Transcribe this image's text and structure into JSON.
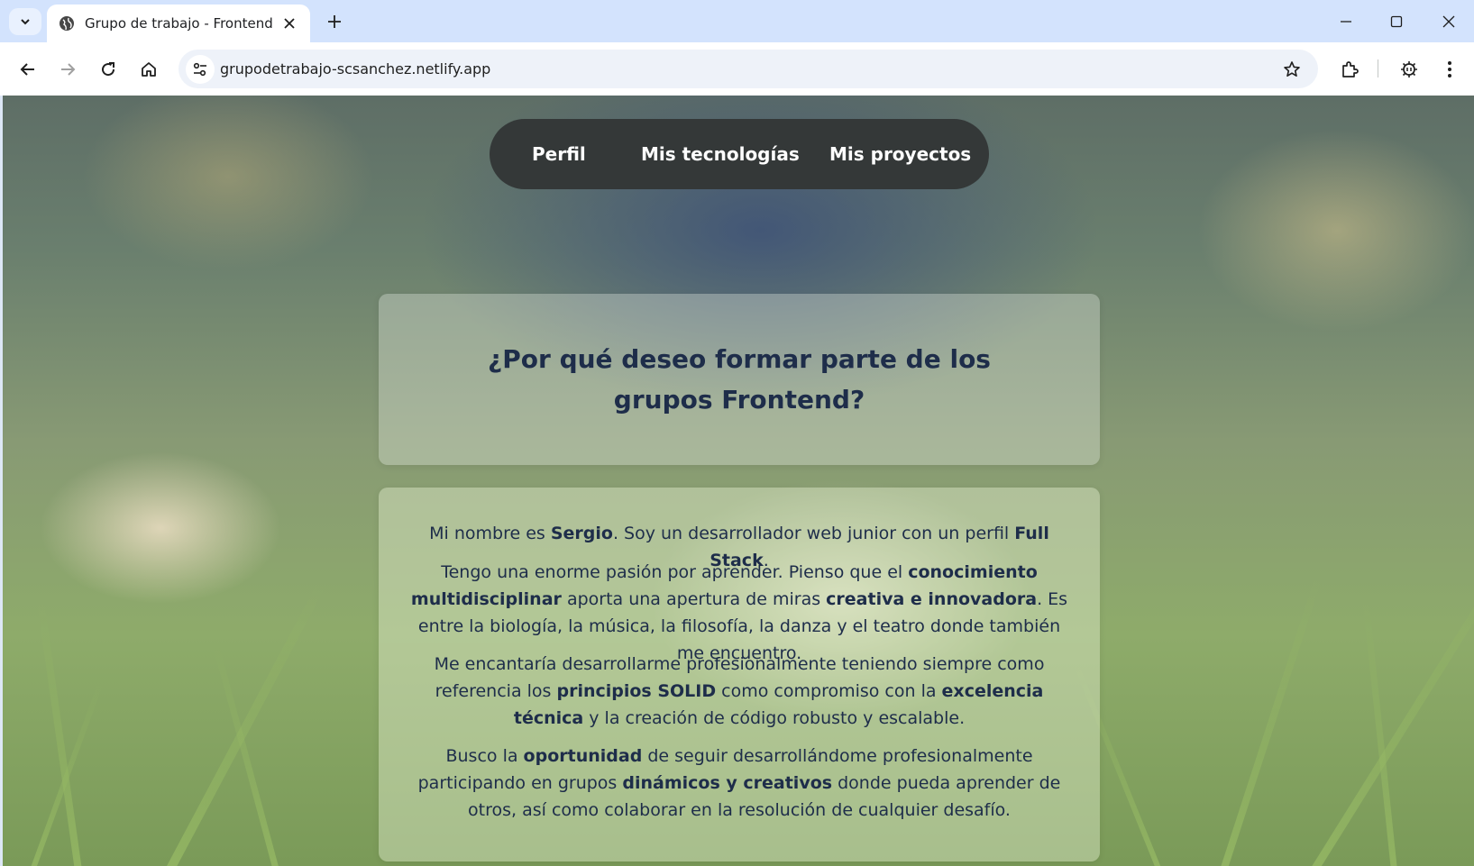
{
  "browser": {
    "tab_title": "Grupo de trabajo - Frontend",
    "url": "grupodetrabajo-scsanchez.netlify.app"
  },
  "nav": {
    "items": [
      "Perfil",
      "Mis tecnologías",
      "Mis proyectos"
    ]
  },
  "main": {
    "heading": "¿Por qué deseo formar parte de los grupos Frontend?",
    "p1": [
      "Mi nombre es ",
      "Sergio",
      ". Soy un desarrollador web junior con un perfil ",
      "Full Stack",
      "."
    ],
    "p2": [
      "Tengo una enorme pasión por aprender. Pienso que el ",
      "conocimiento multidisciplinar",
      " aporta una apertura de miras ",
      "creativa e innovadora",
      ". Es entre la biología, la música, la filosofía, la danza y el teatro donde también me encuentro."
    ],
    "p3": [
      "Me encantaría desarrollarme profesionalmente teniendo siempre como referencia los ",
      "principios SOLID",
      " como compromiso con la ",
      "excelencia técnica",
      " y la creación de código robusto y escalable."
    ],
    "p4": [
      "Busco la ",
      "oportunidad",
      " de seguir desarrollándome profesionalmente participando en grupos ",
      "dinámicos y creativos",
      " donde pueda aprender de otros, así como colaborar en la resolución de cualquier desafío."
    ]
  },
  "colors": {
    "tabstrip": "#d3e3fd",
    "nav_pill": "#343838",
    "heading_text": "#1e2d4a"
  }
}
